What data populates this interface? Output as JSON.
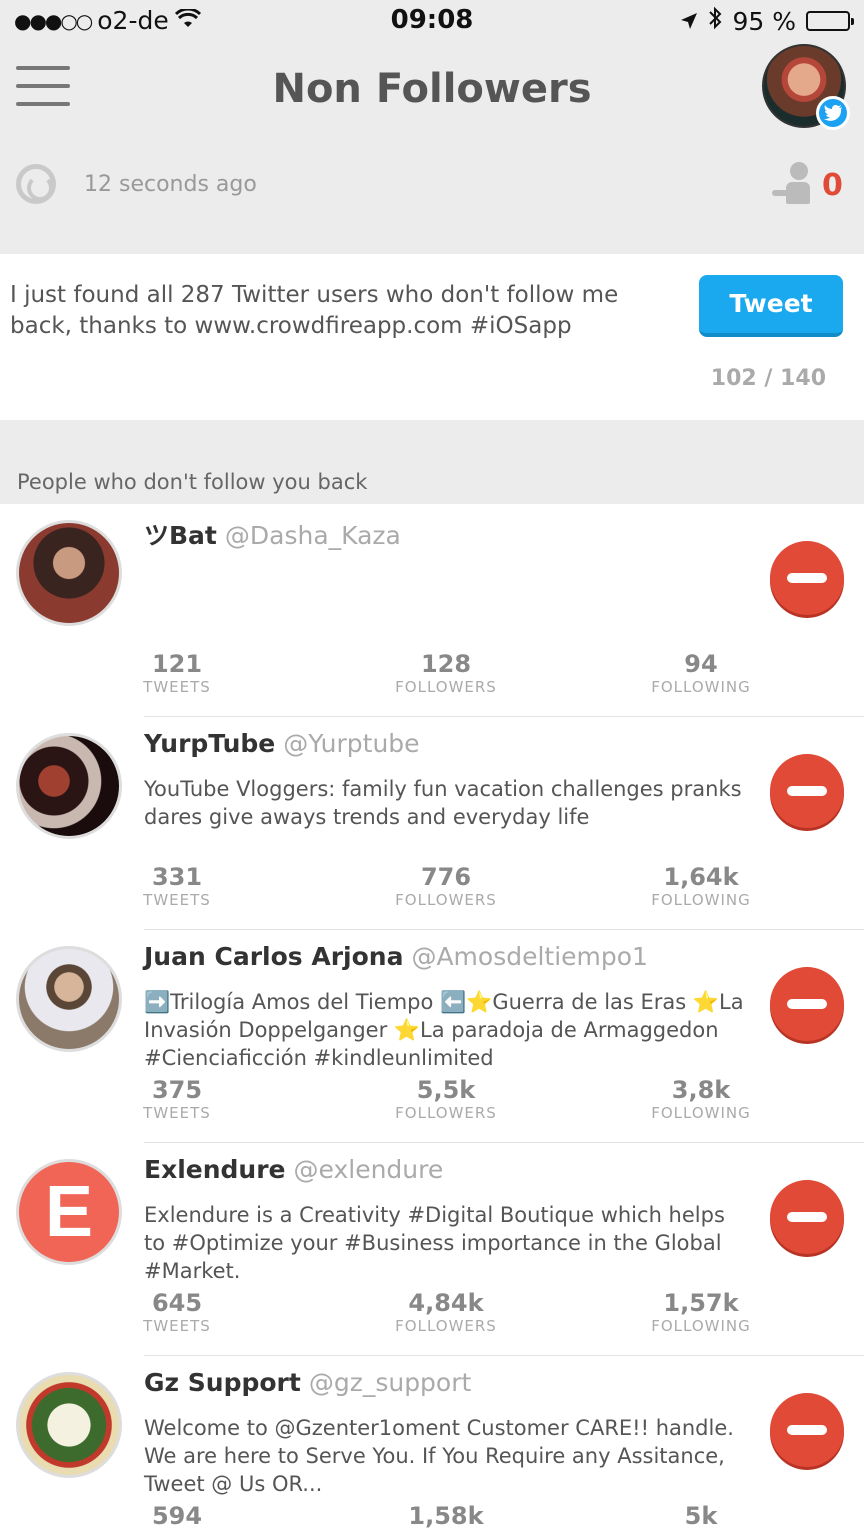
{
  "status_bar": {
    "signal": "●●●○○",
    "carrier": "o2-de",
    "wifi_icon": "wifi-icon",
    "time": "09:08",
    "battery": "95 %",
    "battery_level": 0.95
  },
  "header": {
    "title": "Non Followers"
  },
  "sync": {
    "last_updated": "12 seconds ago",
    "unfollow_count": "0"
  },
  "tweet_card": {
    "text": "I just found all 287 Twitter users who don't follow me back, thanks to www.crowdfireapp.com #iOSapp",
    "button_label": "Tweet",
    "char_count": "102 / 140"
  },
  "section": {
    "title": "People who don't follow you back"
  },
  "users": [
    {
      "name": "ツBat",
      "handle": "@Dasha_Kaza",
      "bio": "",
      "tweets": "121",
      "followers": "128",
      "following": "94",
      "avatar_color": "#5a3a35"
    },
    {
      "name": "YurpTube",
      "handle": "@Yurptube",
      "bio": "YouTube Vloggers: family fun vacation challenges pranks dares give aways trends and everyday life",
      "tweets": "331",
      "followers": "776",
      "following": "1,64k",
      "avatar_color": "#2a1414"
    },
    {
      "name": "Juan Carlos Arjona",
      "handle": "@Amosdeltiempo1",
      "bio": "➡️Trilogía Amos del Tiempo ⬅️⭐️Guerra de las Eras ⭐️La Invasión Doppelganger ⭐️La paradoja de Armaggedon #Cienciaficción #kindleunlimited",
      "tweets": "375",
      "followers": "5,5k",
      "following": "3,8k",
      "avatar_color": "#8b7a6a"
    },
    {
      "name": "Exlendure",
      "handle": "@exlendure",
      "bio": "Exlendure is a Creativity #Digital Boutique which helps to #Optimize your #Business importance in the Global #Market.",
      "tweets": "645",
      "followers": "4,84k",
      "following": "1,57k",
      "avatar_color": "#f06556",
      "avatar_letter": "E"
    },
    {
      "name": "Gz Support",
      "handle": "@gz_support",
      "bio": "Welcome to @Gzenter1oment Customer CARE!! handle. We are here to Serve You. If You Require any Assitance, Tweet @ Us OR...",
      "tweets": "594",
      "followers": "1,58k",
      "following": "5k",
      "avatar_color": "#3d6b2e"
    }
  ],
  "stat_labels": {
    "tweets": "Tweets",
    "followers": "Followers",
    "following": "Following"
  },
  "colors": {
    "accent_red": "#e14a37",
    "tweet_blue": "#1aa9ef",
    "background": "#ececec"
  }
}
